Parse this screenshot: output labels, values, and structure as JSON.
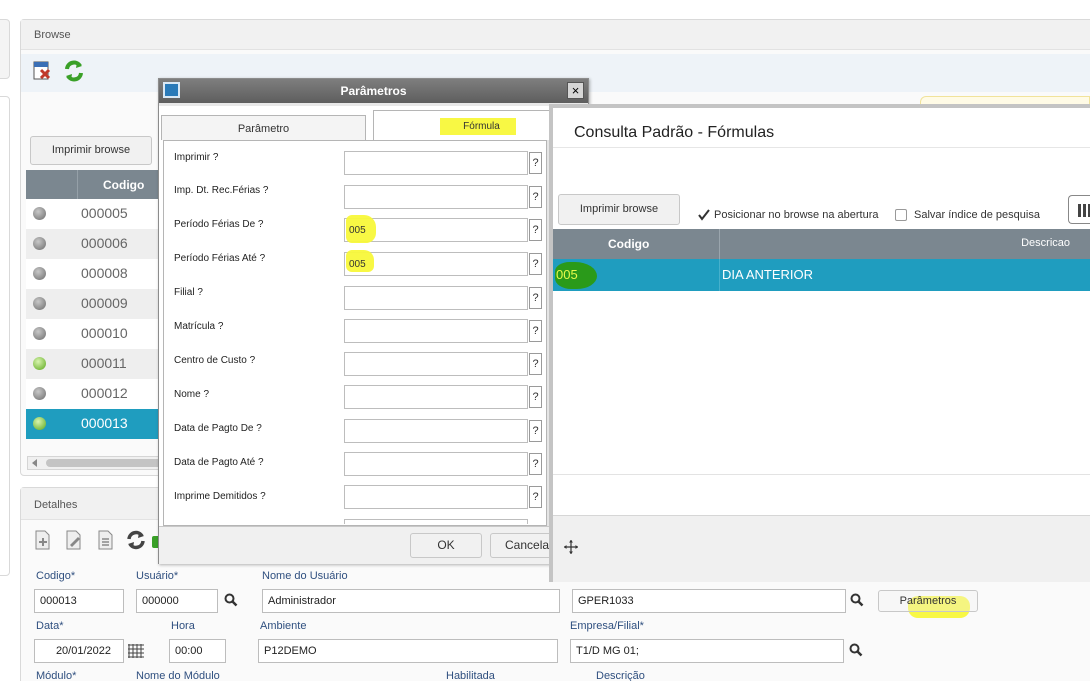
{
  "browse": {
    "title": "Browse",
    "print_button": "Imprimir browse",
    "column_code": "Codigo",
    "rows": [
      {
        "code": "000005",
        "status": "gray"
      },
      {
        "code": "000006",
        "status": "gray"
      },
      {
        "code": "000008",
        "status": "gray"
      },
      {
        "code": "000009",
        "status": "gray"
      },
      {
        "code": "000010",
        "status": "gray"
      },
      {
        "code": "000011",
        "status": "green"
      },
      {
        "code": "000012",
        "status": "gray"
      },
      {
        "code": "000013",
        "status": "green",
        "selected": true
      }
    ]
  },
  "details": {
    "title": "Detalhes",
    "fields": {
      "codigo_label": "Codigo*",
      "codigo_value": "000013",
      "usuario_label": "Usuário*",
      "usuario_value": "000000",
      "nome_usuario_label": "Nome do Usuário",
      "nome_usuario_value": "Administrador",
      "formula_value": "GPER1033",
      "parametros_button": "Parâmetros",
      "data_label": "Data*",
      "data_value": "20/01/2022",
      "hora_label": "Hora",
      "hora_value": "00:00",
      "ambiente_label": "Ambiente",
      "ambiente_value": "P12DEMO",
      "empresa_label": "Empresa/Filial*",
      "empresa_value": "T1/D MG 01;",
      "modulo_label": "Módulo*",
      "nome_modulo_label": "Nome do Módulo",
      "habilitada_label": "Habilitada",
      "descricao_label": "Descrição"
    }
  },
  "params_dialog": {
    "title": "Parâmetros",
    "close": "×",
    "tab_param": "Parâmetro",
    "tab_formula": "Fórmula",
    "question_mark": "?",
    "fields": [
      {
        "label": "Imprimir ?",
        "value": ""
      },
      {
        "label": "Imp. Dt. Rec.Férias ?",
        "value": ""
      },
      {
        "label": "Período Férias De ?",
        "value": "005"
      },
      {
        "label": "Período Férias Até ?",
        "value": "005"
      },
      {
        "label": "Filial ?",
        "value": ""
      },
      {
        "label": "Matrícula ?",
        "value": ""
      },
      {
        "label": "Centro de Custo ?",
        "value": ""
      },
      {
        "label": "Nome ?",
        "value": ""
      },
      {
        "label": "Data de Pagto De ?",
        "value": ""
      },
      {
        "label": "Data de Pagto Até ?",
        "value": ""
      },
      {
        "label": "Imprime Demitidos ?",
        "value": ""
      }
    ],
    "ok_button": "OK",
    "cancel_button": "Cancelar"
  },
  "lookup_dialog": {
    "title": "Consulta Padrão - Fórmulas",
    "print_button": "Imprimir browse",
    "check_position": "Posicionar no browse na abertura",
    "check_position_checked": true,
    "check_save_index": "Salvar índice de pesquisa",
    "check_save_index_checked": false,
    "col_code": "Codigo",
    "col_desc": "Descricao",
    "rows": [
      {
        "code": "005",
        "desc": "DIA ANTERIOR"
      }
    ]
  }
}
